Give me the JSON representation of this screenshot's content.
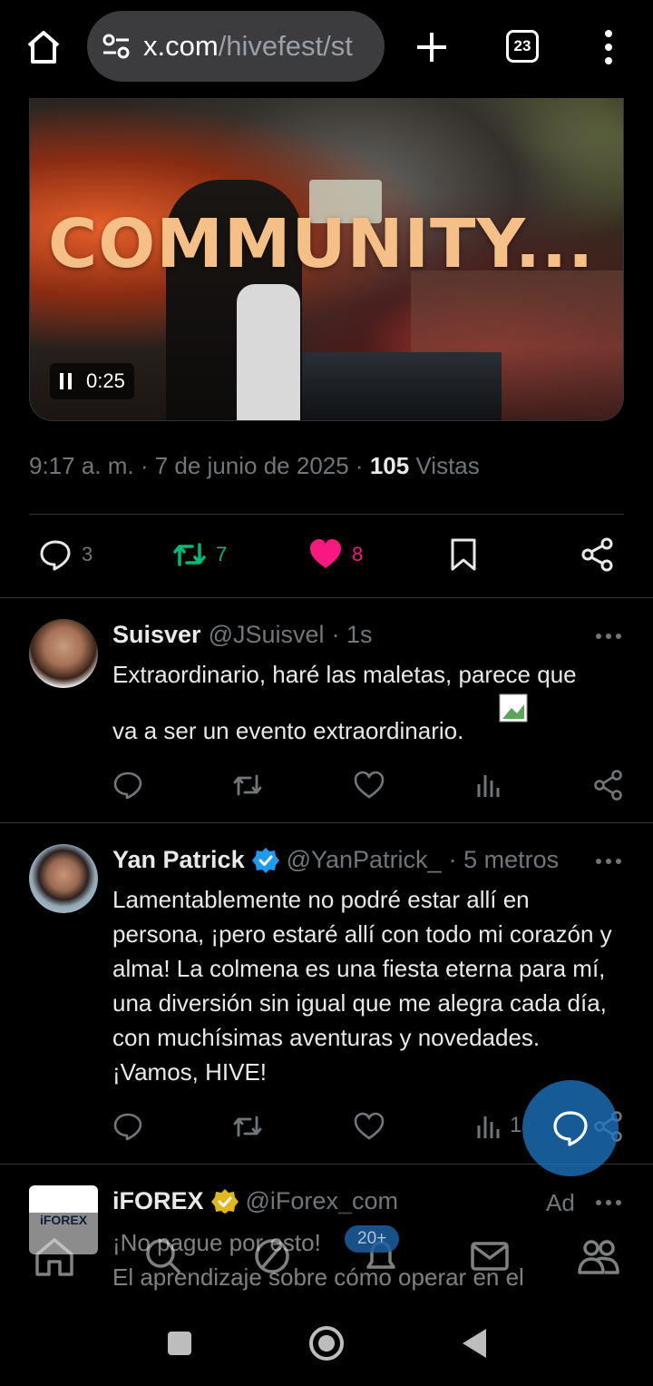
{
  "browser": {
    "url_host": "x.com",
    "url_path": "/hivefest/st",
    "tab_count": "23"
  },
  "video": {
    "caption": "COMMUNITY...",
    "time": "0:25"
  },
  "post_meta": {
    "time": "9:17 a. m.",
    "date": "7 de junio de 2025",
    "views_count": "105",
    "views_label": "Vistas"
  },
  "stats": {
    "replies": "3",
    "reposts": "7",
    "likes": "8"
  },
  "replies": [
    {
      "name": "Suisver",
      "handle": "@JSuisvel",
      "time": "· 1s",
      "text_line1": "Extraordinario, haré las maletas, parece que",
      "text_line2": "va a ser un evento extraordinario."
    },
    {
      "name": "Yan Patrick",
      "handle": "@YanPatrick_",
      "time": "· 5 metros",
      "text": "Lamentablemente no podré estar allí en persona, ¡pero estaré allí con todo mi corazón y alma! La colmena es una fiesta eterna para mí, una diversión sin igual que me alegra cada día, con muchísimas aventuras y novedades. ¡Vamos, HIVE!",
      "views": "1"
    }
  ],
  "ad": {
    "name": "iFOREX",
    "handle": "@iForex_com",
    "label": "Ad",
    "logo_text": "iFOREX",
    "line1": "¡No pague por esto!",
    "line2": "El aprendizaje sobre cómo operar en el"
  },
  "tabbar": {
    "badge": "20+"
  },
  "colors": {
    "like": "#f91880",
    "repost": "#00ba7c",
    "verified_blue": "#1d9bf0",
    "verified_gold": "#e2b719"
  }
}
